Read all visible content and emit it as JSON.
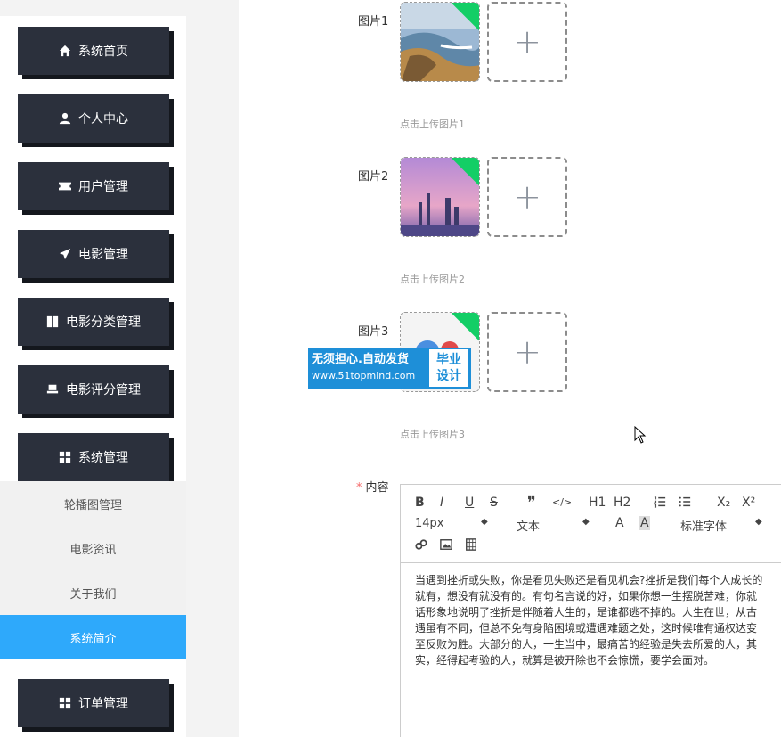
{
  "sidebar": {
    "items": [
      {
        "label": "系统首页",
        "icon": "home-icon"
      },
      {
        "label": "个人中心",
        "icon": "user-icon"
      },
      {
        "label": "用户管理",
        "icon": "ticket-icon"
      },
      {
        "label": "电影管理",
        "icon": "send-icon"
      },
      {
        "label": "电影分类管理",
        "icon": "book-icon"
      },
      {
        "label": "电影评分管理",
        "icon": "chair-icon"
      },
      {
        "label": "系统管理",
        "icon": "grid-icon"
      },
      {
        "label": "订单管理",
        "icon": "grid-icon"
      }
    ],
    "submenu": [
      "轮播图管理",
      "电影资讯",
      "关于我们",
      "系统简介"
    ],
    "active_submenu": "系统简介"
  },
  "form": {
    "images": [
      {
        "label": "图片1",
        "hint": "点击上传图片1"
      },
      {
        "label": "图片2",
        "hint": "点击上传图片2"
      },
      {
        "label": "图片3",
        "hint": "点击上传图片3"
      }
    ],
    "content_label": "内容",
    "required_mark": "*",
    "upload_plus": "+"
  },
  "watermark": {
    "line1": "无须担心.自动发货",
    "line2": "www.51topmind.com",
    "badge_line1": "毕业",
    "badge_line2": "设计"
  },
  "editor": {
    "toolbar_row1": [
      "B",
      "I",
      "U",
      "S",
      "❞",
      "</>",
      "H1",
      "H2",
      "ol",
      "ul",
      "X₂",
      "X²"
    ],
    "font_size": "14px",
    "paragraph": "文本",
    "font_family": "标准字体",
    "content_lines": [
      "当遇到挫折或失败，你是看见失败还是看见机会?挫折是我们每个人成长的",
      "就有，想没有就没有的。有句名言说的好，如果你想一生摆脱苦难，你就",
      "话形象地说明了挫折是伴随着人生的，是谁都逃不掉的。人生在世，从古",
      "遇虽有不同，但总不免有身陷困境或遭遇难题之处，这时候唯有通权达变",
      "至反败为胜。大部分的人，一生当中，最痛苦的经验是失去所爱的人，其",
      "实，经得起考验的人，就算是被开除也不会惊慌，要学会面对。"
    ]
  },
  "colors": {
    "menu_bg": "#2b303c",
    "active_blue": "#2ea9fb",
    "success_green": "#13ce66",
    "watermark_blue": "#1e8fd8"
  }
}
